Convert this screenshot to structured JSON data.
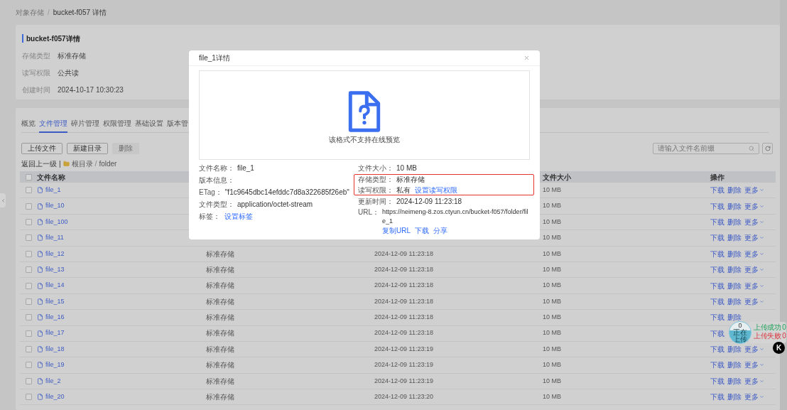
{
  "breadcrumb": {
    "items": [
      "对象存储",
      "bucket-f057 详情"
    ],
    "separator": "/"
  },
  "bucket": {
    "title": "bucket-f057详情",
    "fields": [
      {
        "label": "存储类型",
        "value": "标准存储"
      },
      {
        "label": "读写权限",
        "value": "公共读"
      },
      {
        "label": "创建时间",
        "value": "2024-10-17 10:30:23"
      }
    ]
  },
  "tabs": [
    {
      "label": "概览",
      "selected": false
    },
    {
      "label": "文件管理",
      "selected": true
    },
    {
      "label": "碎片管理",
      "selected": false
    },
    {
      "label": "权限管理",
      "selected": false
    },
    {
      "label": "基础设置",
      "selected": false
    },
    {
      "label": "版本管",
      "selected": false
    }
  ],
  "toolbar": {
    "buttons": [
      {
        "label": "上传文件",
        "disabled": false
      },
      {
        "label": "新建目录",
        "disabled": false
      },
      {
        "label": "删除",
        "disabled": true
      }
    ],
    "search": {
      "placeholder": "请输入文件名前缀"
    }
  },
  "path": {
    "back": "返回上一级",
    "separator": "|",
    "root": "根目录",
    "divider": "/",
    "current": "folder"
  },
  "table": {
    "header": {
      "checked": false,
      "name": "文件名称",
      "size": "文件大小",
      "actions": "操作"
    },
    "rows": [
      {
        "checked": false,
        "name": "file_1",
        "size": "10 MB",
        "actions": [
          {
            "kind": "link",
            "label": "下载"
          },
          {
            "kind": "link",
            "label": "删除"
          },
          {
            "kind": "menu",
            "label": "更多"
          }
        ]
      },
      {
        "checked": false,
        "name": "file_10",
        "size": "10 MB",
        "actions": [
          {
            "kind": "link",
            "label": "下载"
          },
          {
            "kind": "link",
            "label": "删除"
          },
          {
            "kind": "menu",
            "label": "更多"
          }
        ]
      },
      {
        "checked": false,
        "name": "file_100",
        "size": "10 MB",
        "actions": [
          {
            "kind": "link",
            "label": "下载"
          },
          {
            "kind": "link",
            "label": "删除"
          },
          {
            "kind": "menu",
            "label": "更多"
          }
        ]
      },
      {
        "checked": false,
        "name": "file_11",
        "size": "10 MB",
        "actions": [
          {
            "kind": "link",
            "label": "下载"
          },
          {
            "kind": "link",
            "label": "删除"
          },
          {
            "kind": "menu",
            "label": "更多"
          }
        ]
      },
      {
        "checked": false,
        "name": "file_12",
        "storage_class": "标准存储",
        "updated": "2024-12-09 11:23:18",
        "size": "10 MB",
        "actions": [
          {
            "kind": "link",
            "label": "下载"
          },
          {
            "kind": "link",
            "label": "删除"
          },
          {
            "kind": "menu",
            "label": "更多"
          }
        ]
      },
      {
        "checked": false,
        "name": "file_13",
        "storage_class": "标准存储",
        "updated": "2024-12-09 11:23:18",
        "size": "10 MB",
        "actions": [
          {
            "kind": "link",
            "label": "下载"
          },
          {
            "kind": "link",
            "label": "删除"
          },
          {
            "kind": "menu",
            "label": "更多"
          }
        ]
      },
      {
        "checked": false,
        "name": "file_14",
        "storage_class": "标准存储",
        "updated": "2024-12-09 11:23:18",
        "size": "10 MB",
        "actions": [
          {
            "kind": "link",
            "label": "下载"
          },
          {
            "kind": "link",
            "label": "删除"
          },
          {
            "kind": "menu",
            "label": "更多"
          }
        ]
      },
      {
        "checked": false,
        "name": "file_15",
        "storage_class": "标准存储",
        "updated": "2024-12-09 11:23:18",
        "size": "10 MB",
        "actions": [
          {
            "kind": "link",
            "label": "下载"
          },
          {
            "kind": "link",
            "label": "删除"
          },
          {
            "kind": "menu",
            "label": "更多"
          }
        ]
      },
      {
        "checked": false,
        "name": "file_16",
        "storage_class": "标准存储",
        "updated": "2024-12-09 11:23:18",
        "size": "10 MB",
        "actions": [
          {
            "kind": "link",
            "label": "下载"
          },
          {
            "kind": "link",
            "label": "删除"
          }
        ]
      },
      {
        "checked": false,
        "name": "file_17",
        "storage_class": "标准存储",
        "updated": "2024-12-09 11:23:18",
        "size": "10 MB",
        "actions": [
          {
            "kind": "link",
            "label": "下载"
          }
        ]
      },
      {
        "checked": false,
        "name": "file_18",
        "storage_class": "标准存储",
        "updated": "2024-12-09 11:23:19",
        "size": "10 MB",
        "actions": [
          {
            "kind": "link",
            "label": "下载"
          },
          {
            "kind": "link",
            "label": "删除"
          },
          {
            "kind": "menu",
            "label": "更多"
          }
        ]
      },
      {
        "checked": false,
        "name": "file_19",
        "storage_class": "标准存储",
        "updated": "2024-12-09 11:23:19",
        "size": "10 MB",
        "actions": [
          {
            "kind": "link",
            "label": "下载"
          },
          {
            "kind": "link",
            "label": "删除"
          },
          {
            "kind": "menu",
            "label": "更多"
          }
        ]
      },
      {
        "checked": false,
        "name": "file_2",
        "storage_class": "标准存储",
        "updated": "2024-12-09 11:23:19",
        "size": "10 MB",
        "actions": [
          {
            "kind": "link",
            "label": "下载"
          },
          {
            "kind": "link",
            "label": "删除"
          },
          {
            "kind": "menu",
            "label": "更多"
          }
        ]
      },
      {
        "checked": false,
        "name": "file_20",
        "storage_class": "标准存储",
        "updated": "2024-12-09 11:23:20",
        "size": "10 MB",
        "actions": [
          {
            "kind": "link",
            "label": "下载"
          },
          {
            "kind": "link",
            "label": "删除"
          },
          {
            "kind": "menu",
            "label": "更多"
          }
        ]
      }
    ]
  },
  "modal": {
    "title": "file_1详情",
    "preview_message": "该格式不支持在线预览",
    "left": [
      {
        "label": "文件名称：",
        "value": "file_1"
      },
      {
        "label": "版本信息："
      },
      {
        "label": "ETag：",
        "value": "\"f1c9645dbc14efddc7d8a322685f26eb\""
      },
      {
        "label": "文件类型：",
        "value": "application/octet-stream"
      },
      {
        "label": "标签：",
        "links": [
          "设置标签"
        ]
      }
    ],
    "right": [
      {
        "label": "文件大小：",
        "value": "10 MB",
        "highlighted": false
      },
      {
        "label": "存储类型：",
        "value": "标准存储",
        "highlighted": true
      },
      {
        "label": "读写权限：",
        "value": "私有",
        "links": [
          "设置读写权限"
        ],
        "highlighted": true
      },
      {
        "label": "更新时间：",
        "value": "2024-12-09 11:23:18",
        "highlighted": false
      },
      {
        "label": "URL：",
        "value": "https://neimeng-8.zos.ctyun.cn/bucket-f057/folder/file_1",
        "links": [
          "复制URL",
          "下载",
          "分享"
        ],
        "highlighted": false
      }
    ]
  },
  "upload_widget": {
    "count": "0",
    "status": "正在上传",
    "success": "上传成功 0",
    "failed": "上传失败 0",
    "badge": "K"
  }
}
